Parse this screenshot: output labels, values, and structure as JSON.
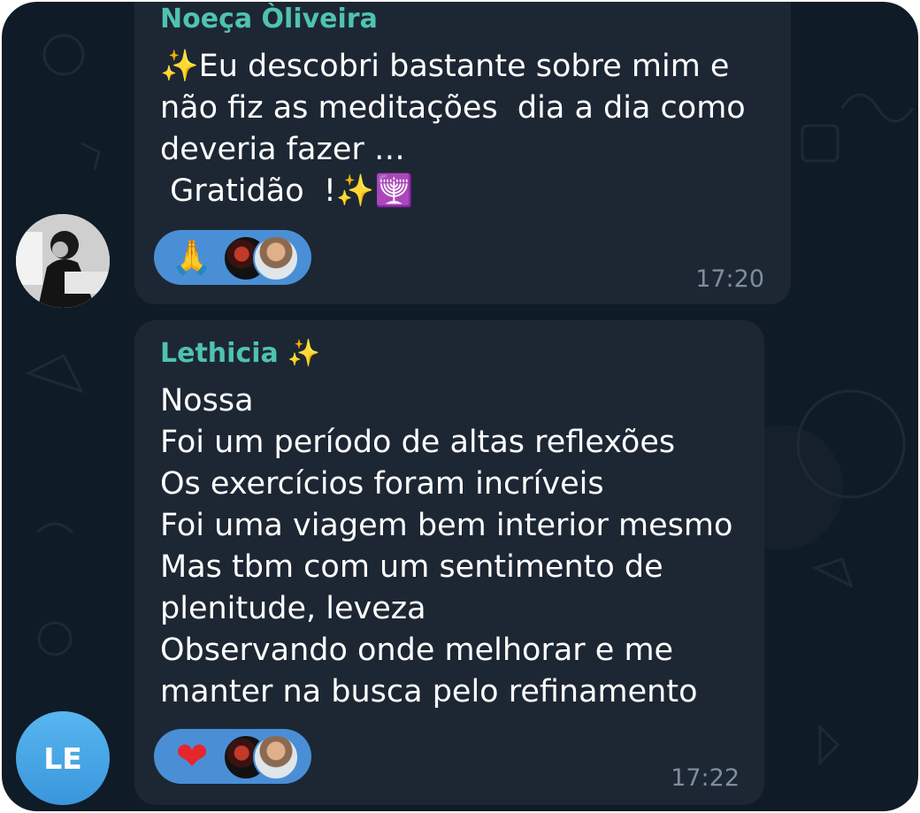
{
  "messages": [
    {
      "sender": "Noeça Òliveira",
      "lines": [
        "✨Eu descobri bastante sobre mim e",
        "não fiz as meditações  dia a dia como",
        "deveria fazer …",
        " Gratidão  !✨🕎"
      ],
      "reactions": {
        "emoji": "🙏",
        "reactor_icons": [
          "reactor-avatar-icon",
          "reactor-avatar-icon"
        ]
      },
      "time": "17:20",
      "avatar_icon": "profile-photo-icon"
    },
    {
      "sender": "Lethicia",
      "sender_emoji": "✨",
      "lines": [
        "Nossa",
        "Foi um período de altas reflexões",
        "Os exercícios foram incríveis",
        "Foi uma viagem bem interior mesmo",
        "Mas tbm com um sentimento de",
        "plenitude, leveza",
        "Observando onde melhorar e me",
        "manter na busca pelo refinamento"
      ],
      "reactions": {
        "emoji": "❤",
        "reactor_icons": [
          "reactor-avatar-icon",
          "reactor-avatar-icon"
        ]
      },
      "time": "17:22",
      "avatar_initials": "LE"
    }
  ],
  "colors": {
    "background": "#0f1b26",
    "bubble": "#1d2733",
    "sender_name": "#4fc2b2",
    "reaction_pill": "#4a8fd6",
    "timestamp": "#7d8e9f",
    "avatar_le": "#3a96dc"
  }
}
